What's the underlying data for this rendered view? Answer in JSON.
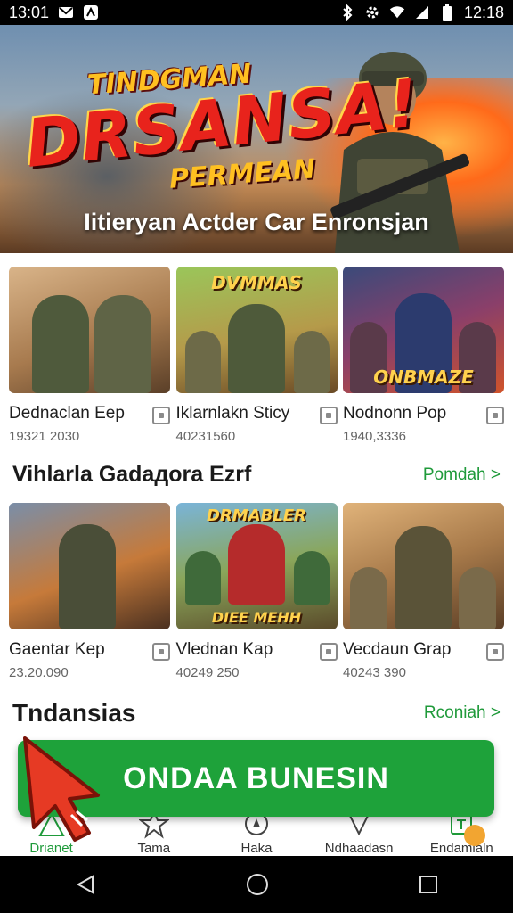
{
  "status_bar": {
    "time_left": "13:01",
    "time_right": "12:18",
    "icons": [
      "gmail-icon",
      "notification-icon",
      "bluetooth-icon",
      "settings-icon",
      "wifi-icon",
      "signal-icon",
      "battery-icon"
    ]
  },
  "hero": {
    "title_small": "TINDGMAN",
    "title_big": "DRSANSA!",
    "title_sub": "PERMEAN",
    "tagline": "Iitieryan Actder Car Enronsjan"
  },
  "row1": {
    "games": [
      {
        "title": "Dednaclan Eep",
        "count": "19321 2030"
      },
      {
        "title": "Iklarnlakn Sticy",
        "count": "40231560",
        "badge": "DVMMAS"
      },
      {
        "title": "Nodnonn Pop",
        "count": "1940,3336",
        "badge": "ONBMAZE"
      }
    ]
  },
  "section2": {
    "title": "Vihlarla Gadaдora Ezrf",
    "more": "Pomdah >"
  },
  "row2": {
    "games": [
      {
        "title": "Gaentar Kep",
        "count": "23.20.090"
      },
      {
        "title": "Vlednan Kap",
        "count": "40249 250",
        "badge": "DRMABLER",
        "badge2": "DIEE MEHH"
      },
      {
        "title": "Vecdaun Grap",
        "count": "40243 390"
      }
    ]
  },
  "section3": {
    "title": "Tndansias",
    "more": "Rconiah >"
  },
  "cta": {
    "label": "ONDAA BUNESIN"
  },
  "bottom_nav": {
    "items": [
      {
        "label": "Drianet"
      },
      {
        "label": "Tama"
      },
      {
        "label": "Haka"
      },
      {
        "label": "Ndhaadasn"
      },
      {
        "label": "Endamialn"
      }
    ]
  },
  "colors": {
    "accent_green": "#1ea23a",
    "link_green": "#1f9a3a",
    "title_red": "#e8231c",
    "title_gold": "#ffc021"
  }
}
